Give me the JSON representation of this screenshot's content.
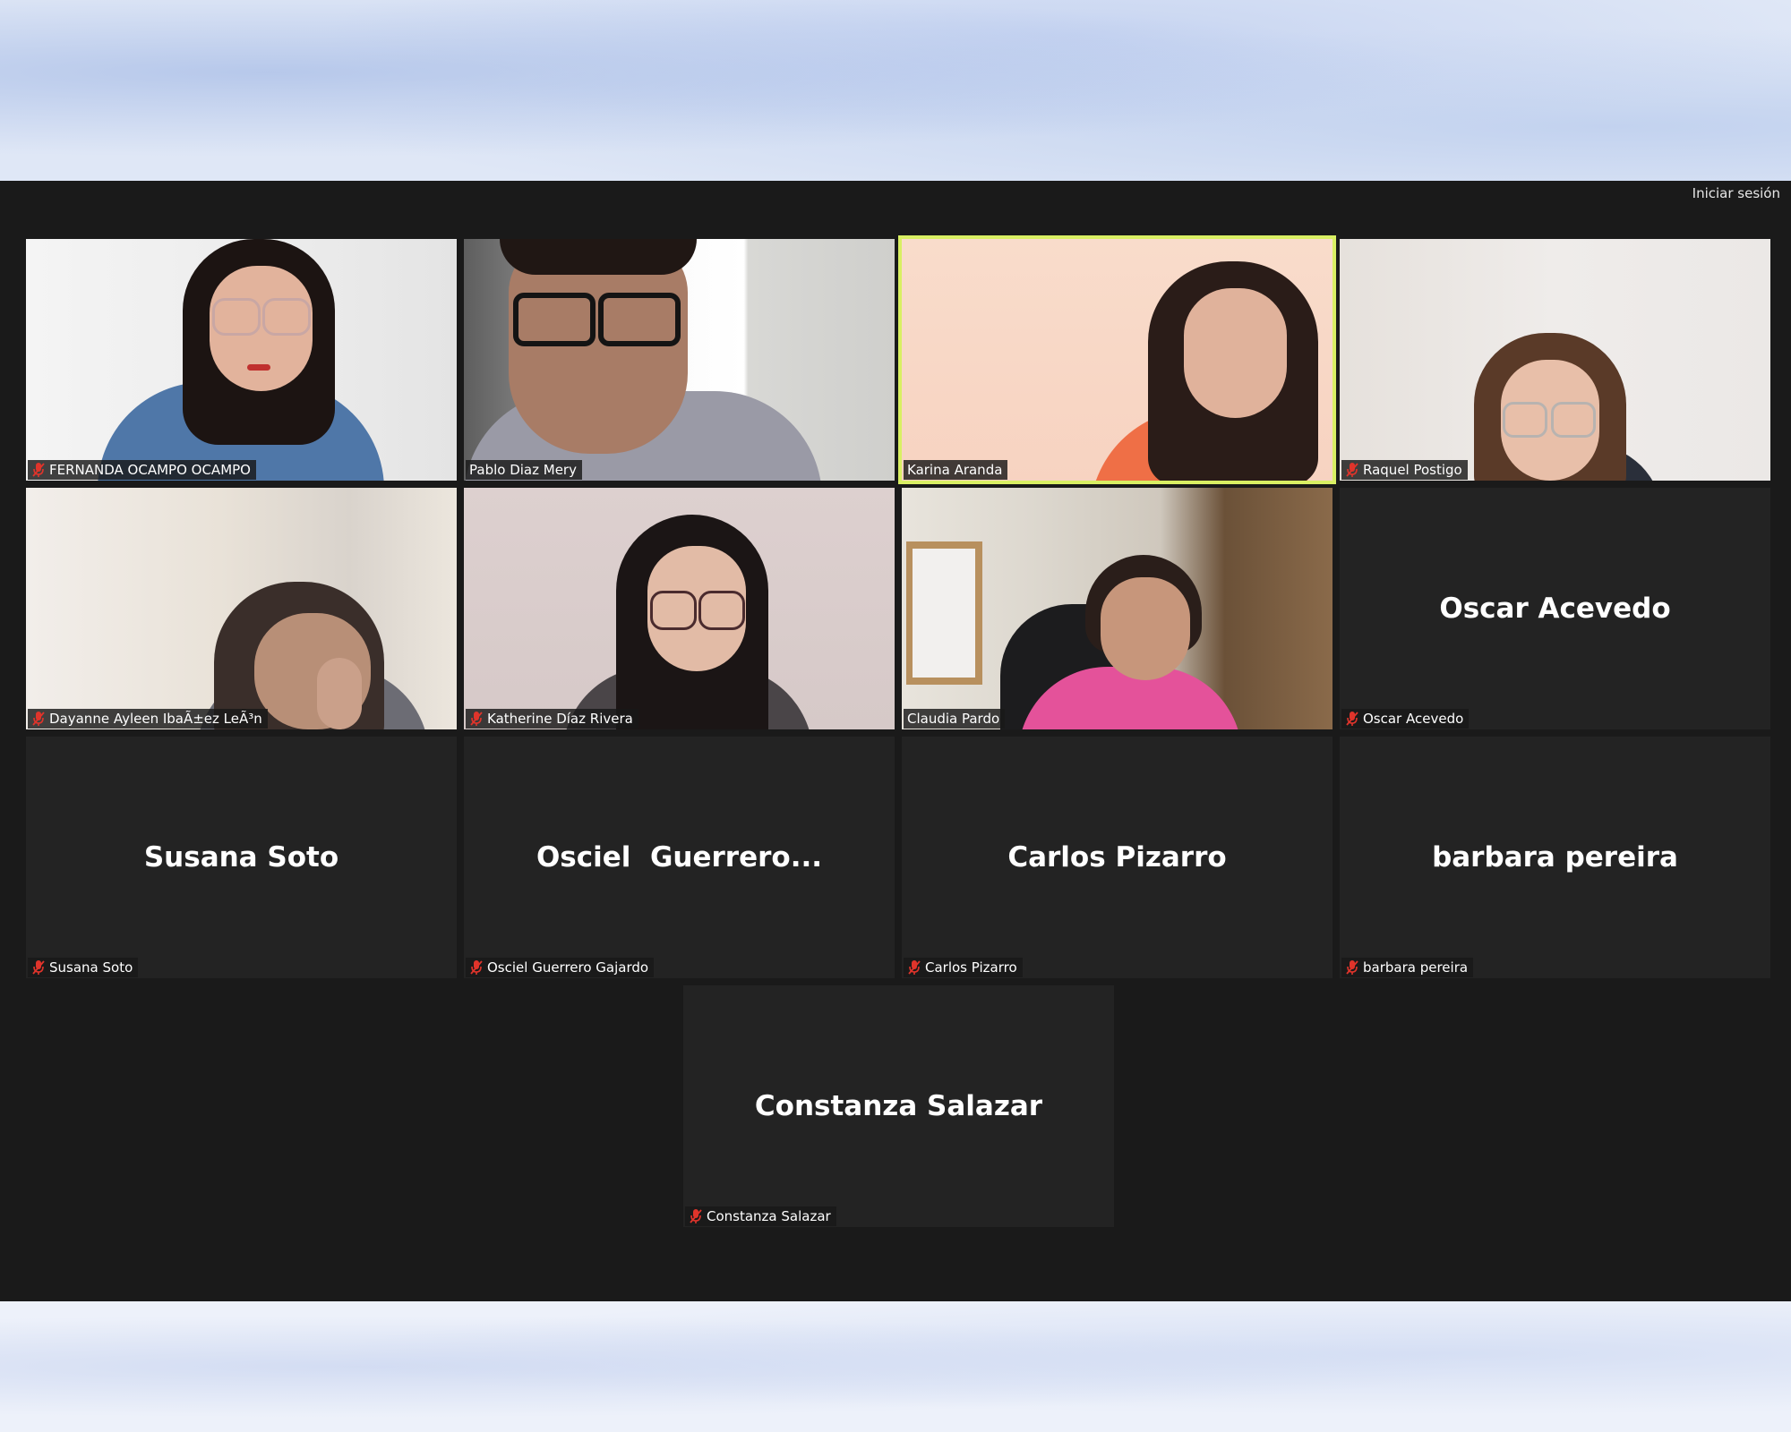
{
  "header": {
    "sign_in_label": "Iniciar sesión"
  },
  "colors": {
    "meeting_bg": "#1a1a1a",
    "tile_bg": "#232323",
    "active_speaker_border": "#d9ef63",
    "muted_icon": "#e0342b"
  },
  "participants": [
    {
      "label": "FERNANDA OCAMPO OCAMPO",
      "muted": true,
      "video": true
    },
    {
      "label": "Pablo Diaz Mery",
      "muted": false,
      "video": true
    },
    {
      "label": "Karina Aranda",
      "muted": false,
      "video": true,
      "active_speaker": true
    },
    {
      "label": "Raquel Postigo",
      "muted": true,
      "video": true
    },
    {
      "label": "Dayanne Ayleen IbaÃ±ez LeÃ³n",
      "muted": true,
      "video": true
    },
    {
      "label": "Katherine Díaz Rivera",
      "muted": true,
      "video": true
    },
    {
      "label": "Claudia Pardo",
      "muted": false,
      "video": true
    },
    {
      "label": "Oscar Acevedo",
      "display_name": "Oscar Acevedo",
      "muted": true,
      "video": false
    },
    {
      "label": "Susana Soto",
      "display_name": "Susana Soto",
      "muted": true,
      "video": false
    },
    {
      "label": "Osciel Guerrero Gajardo",
      "display_name": "Osciel  Guerrero...",
      "muted": true,
      "video": false
    },
    {
      "label": "Carlos Pizarro",
      "display_name": "Carlos Pizarro",
      "muted": true,
      "video": false
    },
    {
      "label": "barbara pereira",
      "display_name": "barbara pereira",
      "muted": true,
      "video": false
    },
    {
      "label": "Constanza Salazar",
      "display_name": "Constanza Salazar",
      "muted": true,
      "video": false
    }
  ]
}
